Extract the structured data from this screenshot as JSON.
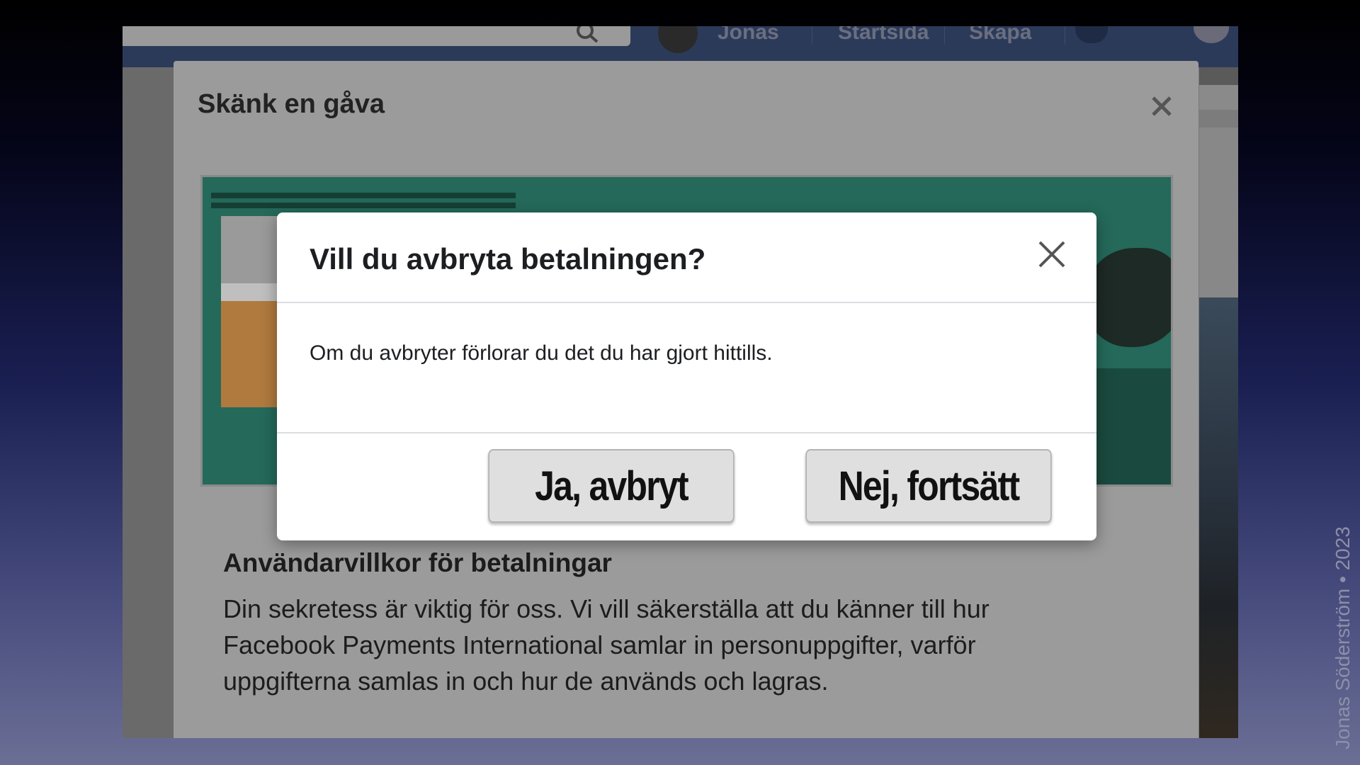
{
  "topbar": {
    "nav_profile": "Jonas",
    "nav_home": "Startsida",
    "nav_create": "Skapa"
  },
  "gift_modal": {
    "title": "Skänk en gåva",
    "terms_title": "Användarvillkor för betalningar",
    "terms_body": "Din sekretess är viktig för oss. Vi vill säkerställa att du känner till hur Facebook Payments International samlar in personuppgifter, varför uppgifterna samlas in och hur de används och lagras."
  },
  "dialog": {
    "title": "Vill du avbryta betalningen?",
    "message": "Om du avbryter förlorar du det du har gjort hittills.",
    "cancel_label": "Ja, avbryt",
    "continue_label": "Nej, fortsätt"
  },
  "watermark": "Jonas Söderström • 2023"
}
